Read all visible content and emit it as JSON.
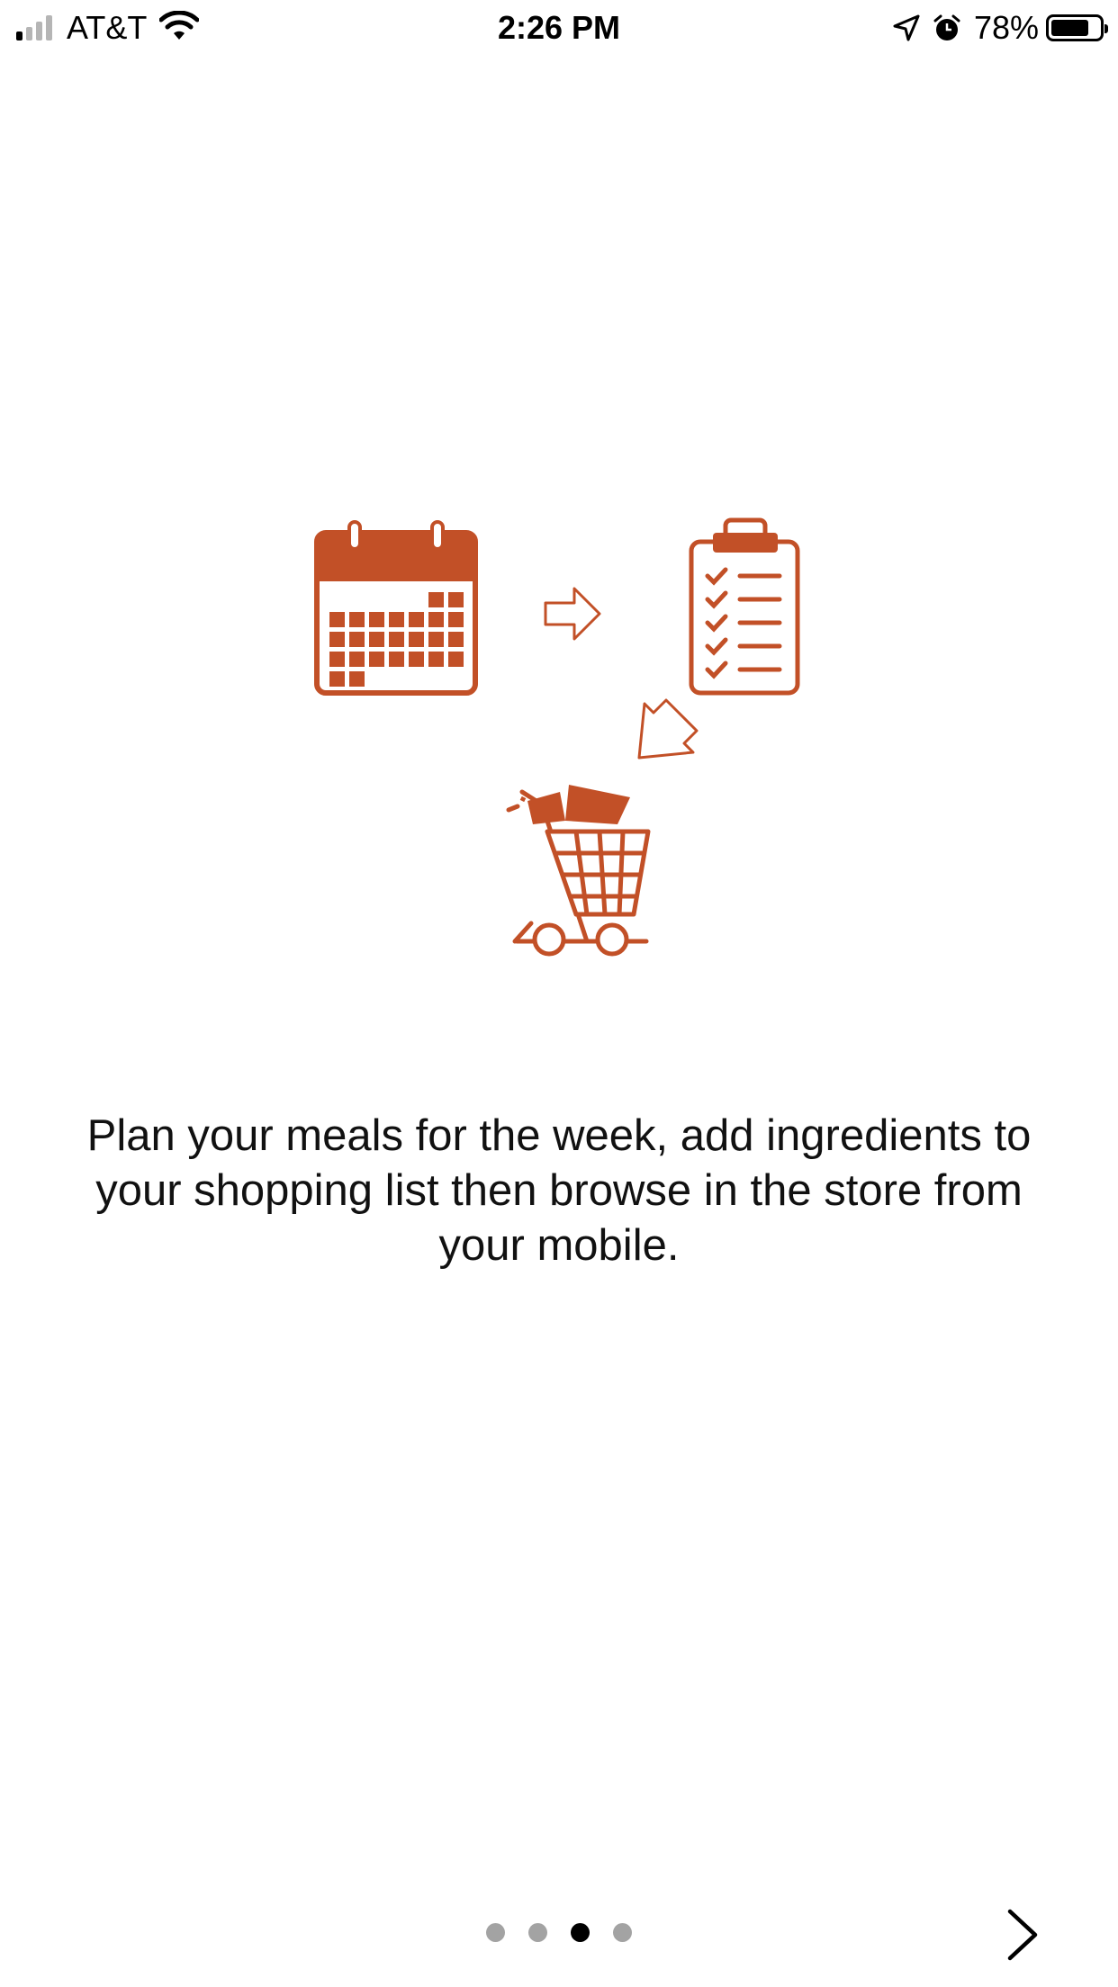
{
  "status_bar": {
    "carrier": "AT&T",
    "time": "2:26 PM",
    "battery_percent": "78%",
    "battery_level": 0.78,
    "signal_bars_active": 1,
    "signal_bars_total": 4,
    "icons": [
      "wifi-icon",
      "location-arrow-icon",
      "alarm-icon",
      "battery-icon"
    ]
  },
  "illustration": {
    "accent_color": "#C25027",
    "icons": [
      "calendar-icon",
      "arrow-right-icon",
      "clipboard-checklist-icon",
      "arrow-down-left-icon",
      "shopping-cart-icon"
    ]
  },
  "onboarding": {
    "description": "Plan your meals for the week, add ingredients to your shopping list then browse in the store from your mobile."
  },
  "pager": {
    "total_pages": 4,
    "current_page": 3
  },
  "navigation": {
    "next_icon": "chevron-right-icon"
  }
}
